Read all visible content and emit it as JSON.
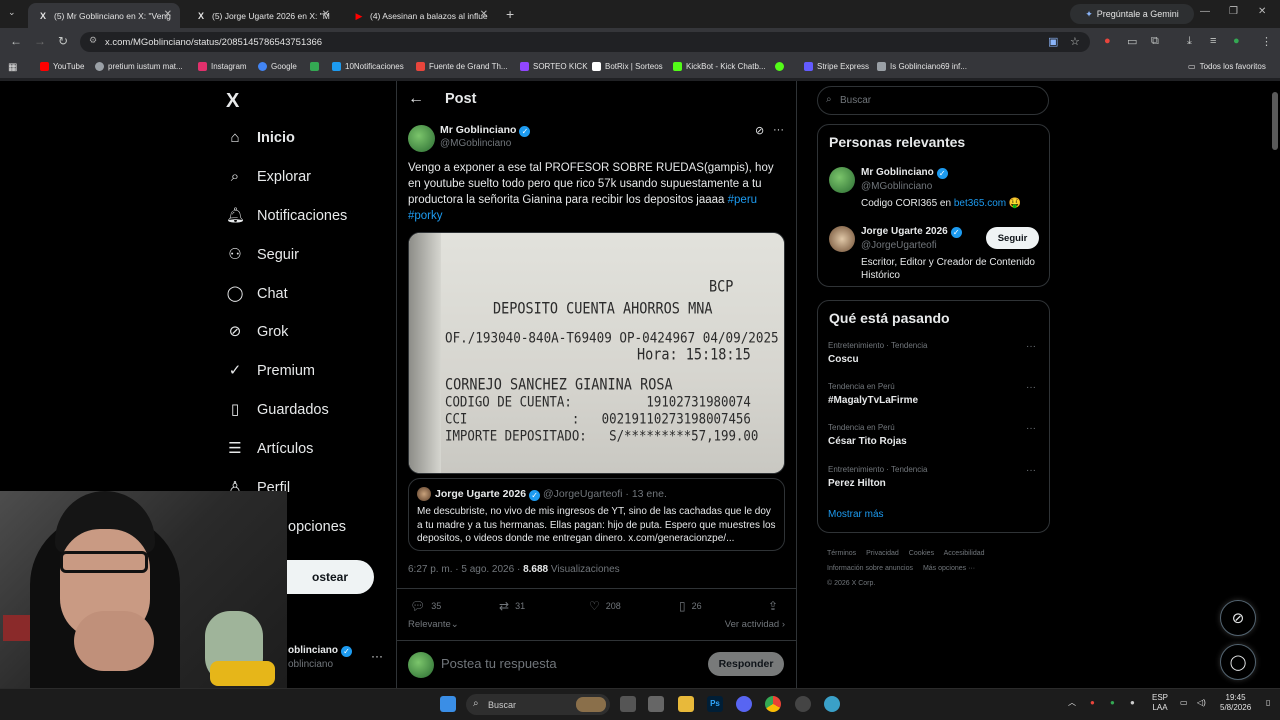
{
  "browser": {
    "tabs": [
      {
        "title": "(5) Mr Goblinciano en X: \"Veng",
        "favicon": "X",
        "active": true
      },
      {
        "title": "(5) Jorge Ugarte 2026 en X: \"M",
        "favicon": "X",
        "active": false
      },
      {
        "title": "(4) Asesinan a balazos al influe",
        "favicon": "▶",
        "active": false
      }
    ],
    "new_tab": "+",
    "gemini": "Pregúntale a Gemini",
    "url": "x.com/MGoblinciano/status/2085145786543751366",
    "bookmarks": [
      {
        "label": "YouTube",
        "color": "#ff0000"
      },
      {
        "label": "pretium iustum mat...",
        "color": "#9aa0a6"
      },
      {
        "label": "Instagram",
        "color": "#e1306c"
      },
      {
        "label": "Google",
        "color": "#4285f4"
      },
      {
        "label": "",
        "color": "#34a853"
      },
      {
        "label": "10Notificaciones",
        "color": "#1d9bf0"
      },
      {
        "label": "Fuente de Grand Th...",
        "color": "#e8453c"
      },
      {
        "label": "SORTEO KICK",
        "color": "#9146ff"
      },
      {
        "label": "BotRix | Sorteos",
        "color": "#ffffff"
      },
      {
        "label": "KickBot - Kick Chatb...",
        "color": "#53fc18"
      },
      {
        "label": "",
        "color": "#53fc18"
      },
      {
        "label": "Stripe Express",
        "color": "#635bff"
      },
      {
        "label": "Is Goblinciano69 inf...",
        "color": "#9aa0a6"
      }
    ],
    "all_bookmarks": "Todos los favoritos"
  },
  "nav": {
    "logo": "X",
    "items": [
      {
        "label": "Inicio",
        "icon": "home-icon",
        "glyph": "⌂"
      },
      {
        "label": "Explorar",
        "icon": "search-icon",
        "glyph": "⌕"
      },
      {
        "label": "Notificaciones",
        "icon": "bell-icon",
        "glyph": "🔔︎"
      },
      {
        "label": "Seguir",
        "icon": "add-user-icon",
        "glyph": "⚇"
      },
      {
        "label": "Chat",
        "icon": "chat-icon",
        "glyph": "◯"
      },
      {
        "label": "Grok",
        "icon": "grok-icon",
        "glyph": "⊘"
      },
      {
        "label": "Premium",
        "icon": "premium-icon",
        "glyph": "✓"
      },
      {
        "label": "Guardados",
        "icon": "bookmark-icon",
        "glyph": "▯"
      },
      {
        "label": "Artículos",
        "icon": "article-icon",
        "glyph": "☰"
      },
      {
        "label": "Perfil",
        "icon": "profile-icon",
        "glyph": "♙"
      },
      {
        "label": "opciones",
        "icon": "more-icon",
        "glyph": ""
      }
    ],
    "post_button": "ostear",
    "account_name": "oblinciano",
    "account_handle": "oblinciano",
    "account_more": "···"
  },
  "post_header": {
    "back": "←",
    "title": "Post"
  },
  "tweet": {
    "author": "Mr Goblinciano",
    "handle": "@MGoblinciano",
    "text_main": "Vengo a exponer a ese tal PROFESOR SOBRE RUEDAS(gampis), hoy en youtube suelto todo pero que rico 57k usando supuestamente a tu productora la señorita Gianina para recibir los depositos jaaaa ",
    "hashtag1": "#peru",
    "hashtag2": "#porky",
    "receipt": {
      "bank": "BCP",
      "heading": "DEPOSITO CUENTA AHORROS MNA",
      "ref": "OF./193040-840A-T69409 OP-0424967 04/09/2025",
      "hora": "Hora: 15:18:15",
      "name": "CORNEJO SANCHEZ GIANINA ROSA",
      "codigo": "CODIGO DE CUENTA:          19102731980074",
      "cci": "CCI              :   00219110273198007456",
      "importe": "IMPORTE DEPOSITADO:   S/*********57,199.00"
    },
    "quote": {
      "author": "Jorge Ugarte 2026",
      "meta": "@JorgeUgarteofi · 13 ene.",
      "text": "Me descubriste, no vivo de mis ingresos de YT, sino de las cachadas que le doy a tu madre y a tus hermanas. Ellas pagan: hijo de puta. Espero que muestres los depositos, o videos donde me entregan dinero. x.com/generacionzpe/..."
    },
    "time": "6:27 p. m. · 5 ago. 2026 · ",
    "views_count": "8.688",
    "views_label": " Visualizaciones",
    "replies": "35",
    "reposts": "31",
    "likes": "208",
    "bookmarks": "26",
    "sort_label": "Relevante",
    "activity_label": "Ver actividad",
    "reply_placeholder": "Postea tu respuesta",
    "reply_button": "Responder"
  },
  "sidebar": {
    "search_placeholder": "Buscar",
    "relevant_title": "Personas relevantes",
    "people": [
      {
        "name": "Mr Goblinciano",
        "handle": "@MGoblinciano",
        "bio": "Codigo CORI365 en ",
        "link": "bet365.com",
        "emoji": "🤑"
      },
      {
        "name": "Jorge Ugarte 2026",
        "handle": "@JorgeUgarteofi",
        "bio": "Escritor, Editor y Creador de Contenido Histórico",
        "follow": "Seguir"
      }
    ],
    "trending_title": "Qué está pasando",
    "trends": [
      {
        "category": "Entretenimiento · Tendencia",
        "name": "Coscu"
      },
      {
        "category": "Tendencia en Perú",
        "name": "#MagalyTvLaFirme"
      },
      {
        "category": "Tendencia en Perú",
        "name": "César Tito Rojas"
      },
      {
        "category": "Entretenimiento · Tendencia",
        "name": "Perez Hilton"
      }
    ],
    "show_more": "Mostrar más",
    "footer": [
      "Términos",
      "Privacidad",
      "Cookies",
      "Accesibilidad",
      "Información sobre anuncios",
      "Más opciones ···",
      "© 2026 X Corp."
    ]
  },
  "taskbar": {
    "search": "Buscar",
    "lang_top": "ESP",
    "lang_bottom": "LAA",
    "time": "19:45",
    "date": "5/8/2026"
  }
}
